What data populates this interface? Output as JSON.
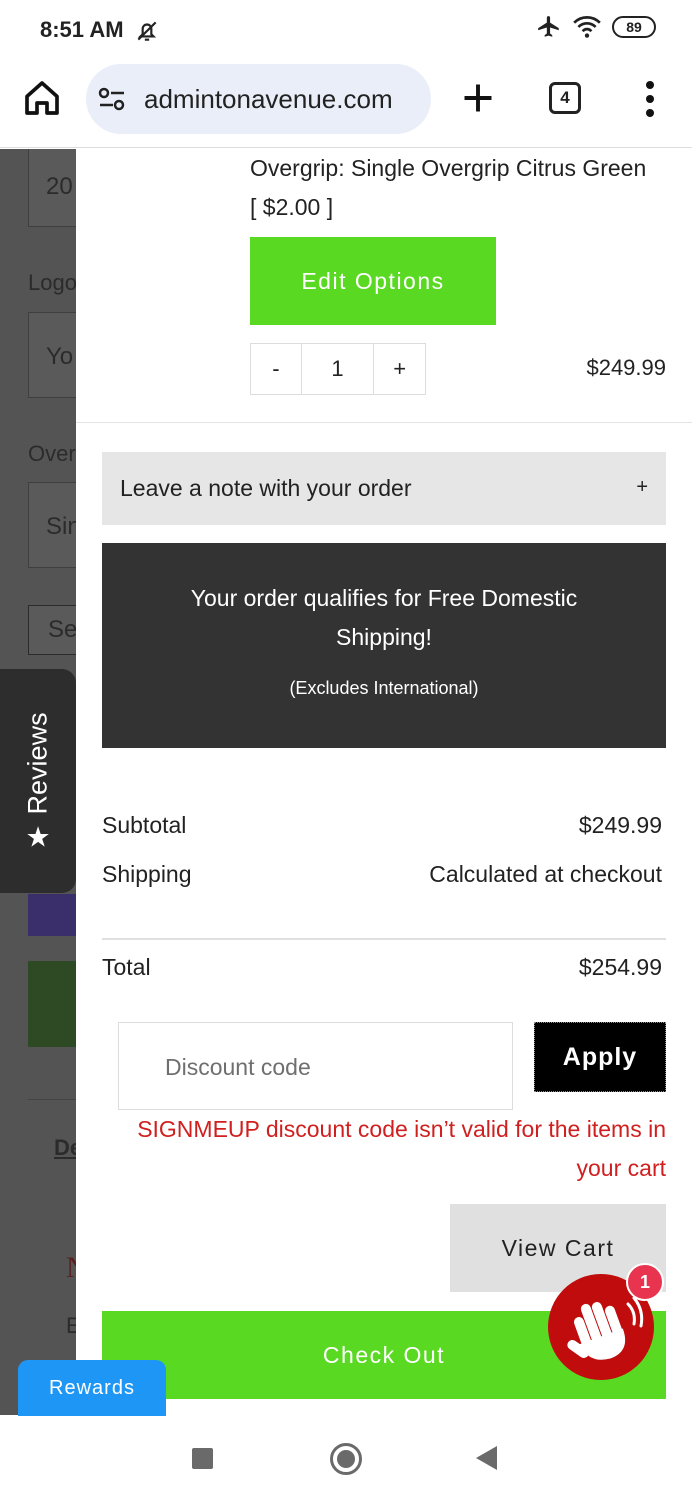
{
  "status_bar": {
    "time": "8:51 AM",
    "battery": "89",
    "icons": [
      "bell-off-icon",
      "airplane-icon",
      "wifi-icon",
      "battery-icon"
    ]
  },
  "browser": {
    "url": "admintonavenue.com",
    "tab_count": "4",
    "icons": [
      "home-icon",
      "site-settings-icon",
      "new-tab-icon",
      "overflow-menu-icon"
    ]
  },
  "background_page": {
    "field_year": "20",
    "label_logo": "Logo",
    "field_logo": "Yo",
    "label_overgrip": "Over",
    "field_overgrip": "Sin",
    "field_select": "Se",
    "link_partial": "De",
    "text_red_partial": "N",
    "text_partial": "E"
  },
  "cart": {
    "item_description": "Overgrip: Single Overgrip Citrus Green [ $2.00 ]",
    "edit_label": "Edit Options",
    "qty_minus": "-",
    "qty_value": "1",
    "qty_plus": "+",
    "line_price": "$249.99",
    "note_label": "Leave a note with your order",
    "note_toggle": "+",
    "shipping_banner_main": "Your order qualifies for Free Domestic Shipping!",
    "shipping_banner_sub": "(Excludes International)",
    "subtotal_label": "Subtotal",
    "subtotal_value": "$249.99",
    "shipping_label": "Shipping",
    "shipping_value": "Calculated at checkout",
    "total_label": "Total",
    "total_value": "$254.99",
    "discount_placeholder": "Discount code",
    "apply_label": "Apply",
    "error_message": "SIGNMEUP discount code isn’t valid for the items in your cart",
    "view_cart_label": "View Cart",
    "checkout_label": "Check Out"
  },
  "floating": {
    "reviews_label": "Reviews",
    "wave_badge": "1",
    "rewards_label": "Rewards"
  },
  "colors": {
    "green": "#5ad922",
    "dark_banner": "#333333",
    "error_red": "#d01f1f",
    "wave_red": "#c00c0c",
    "rewards_blue": "#1e96f5"
  }
}
